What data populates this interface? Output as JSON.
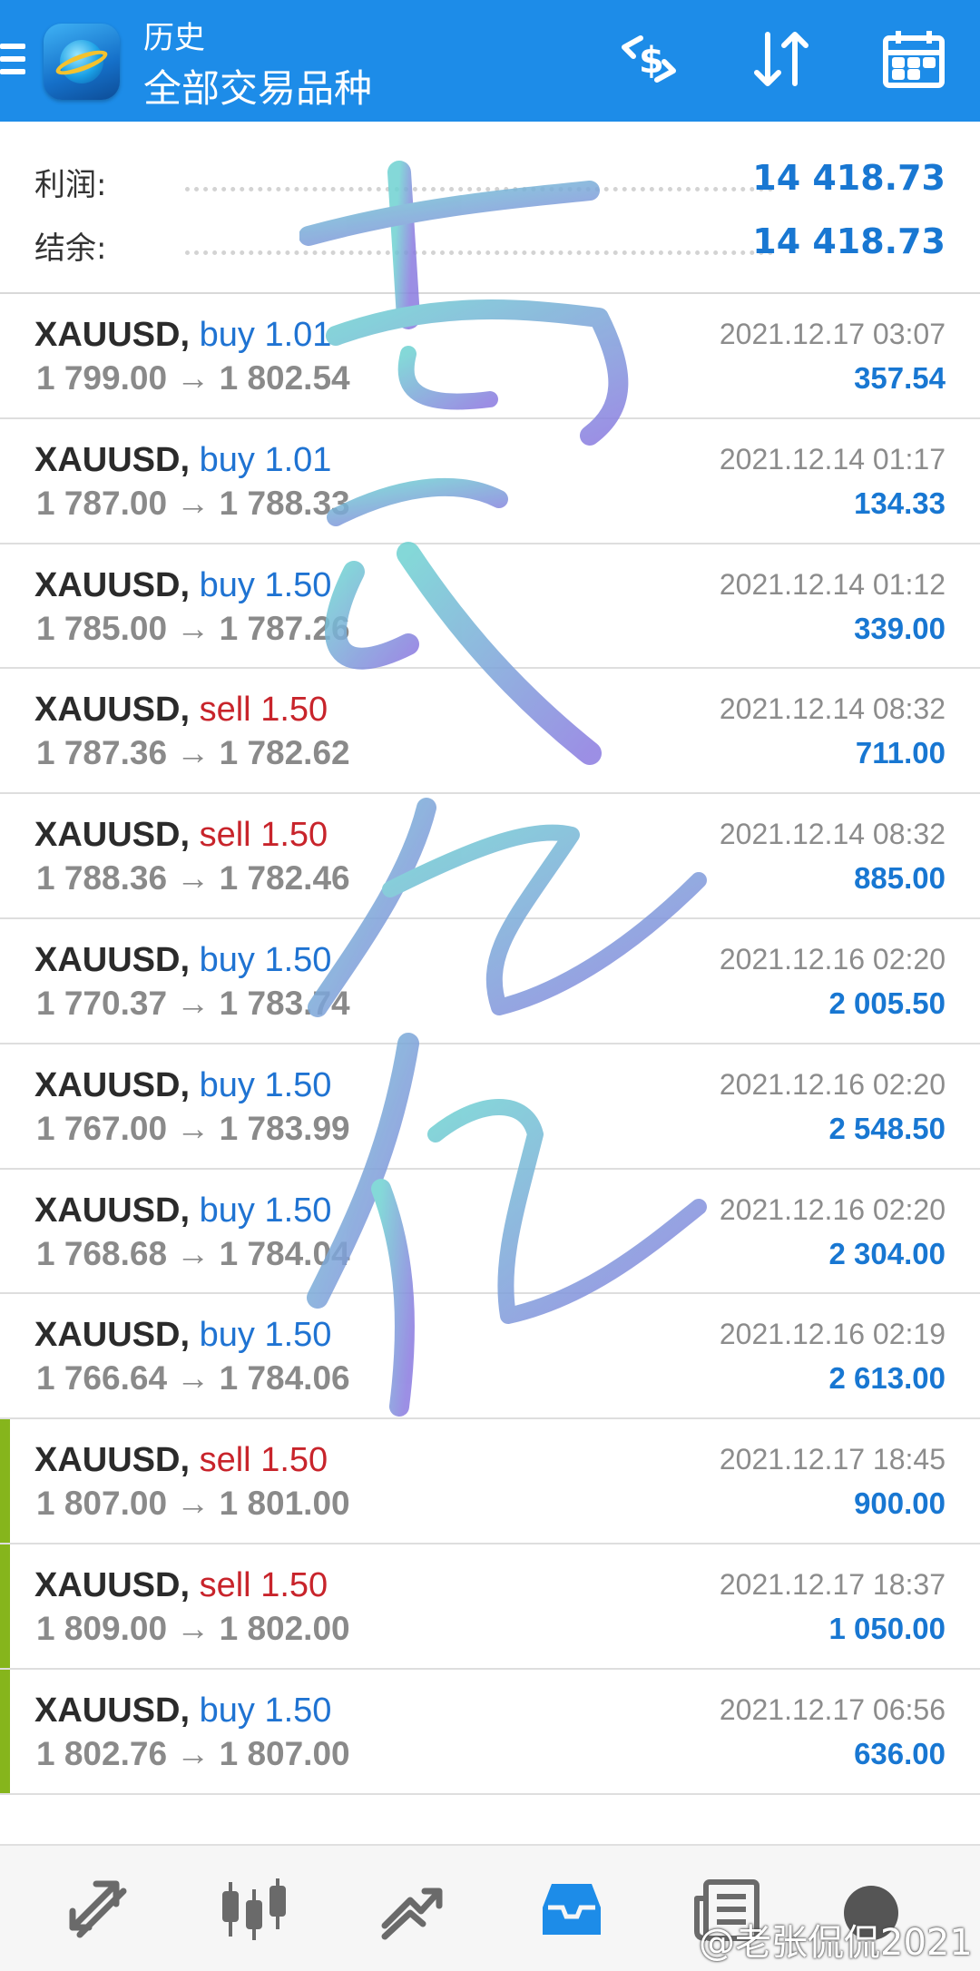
{
  "header": {
    "title": "历史",
    "subtitle": "全部交易品种",
    "icons": [
      "menu-icon",
      "deposit-withdraw-icon",
      "sort-icon",
      "calendar-icon"
    ]
  },
  "summary": {
    "profit_label": "利润:",
    "profit_value": "14 418.73",
    "balance_label": "结余:",
    "balance_value": "14 418.73"
  },
  "trades": [
    {
      "symbol": "XAUUSD,",
      "side": "buy",
      "volume": "1.01",
      "prices": "1 799.00 → 1 802.54",
      "time": "2021.12.17 03:07",
      "profit": "357.54",
      "marked": false
    },
    {
      "symbol": "XAUUSD,",
      "side": "buy",
      "volume": "1.01",
      "prices": "1 787.00 → 1 788.33",
      "time": "2021.12.14 01:17",
      "profit": "134.33",
      "marked": false
    },
    {
      "symbol": "XAUUSD,",
      "side": "buy",
      "volume": "1.50",
      "prices": "1 785.00 → 1 787.26",
      "time": "2021.12.14 01:12",
      "profit": "339.00",
      "marked": false
    },
    {
      "symbol": "XAUUSD,",
      "side": "sell",
      "volume": "1.50",
      "prices": "1 787.36 → 1 782.62",
      "time": "2021.12.14 08:32",
      "profit": "711.00",
      "marked": false
    },
    {
      "symbol": "XAUUSD,",
      "side": "sell",
      "volume": "1.50",
      "prices": "1 788.36 → 1 782.46",
      "time": "2021.12.14 08:32",
      "profit": "885.00",
      "marked": false
    },
    {
      "symbol": "XAUUSD,",
      "side": "buy",
      "volume": "1.50",
      "prices": "1 770.37 → 1 783.74",
      "time": "2021.12.16 02:20",
      "profit": "2 005.50",
      "marked": false
    },
    {
      "symbol": "XAUUSD,",
      "side": "buy",
      "volume": "1.50",
      "prices": "1 767.00 → 1 783.99",
      "time": "2021.12.16 02:20",
      "profit": "2 548.50",
      "marked": false
    },
    {
      "symbol": "XAUUSD,",
      "side": "buy",
      "volume": "1.50",
      "prices": "1 768.68 → 1 784.04",
      "time": "2021.12.16 02:20",
      "profit": "2 304.00",
      "marked": false
    },
    {
      "symbol": "XAUUSD,",
      "side": "buy",
      "volume": "1.50",
      "prices": "1 766.64 → 1 784.06",
      "time": "2021.12.16 02:19",
      "profit": "2 613.00",
      "marked": false
    },
    {
      "symbol": "XAUUSD,",
      "side": "sell",
      "volume": "1.50",
      "prices": "1 807.00 → 1 801.00",
      "time": "2021.12.17 18:45",
      "profit": "900.00",
      "marked": true
    },
    {
      "symbol": "XAUUSD,",
      "side": "sell",
      "volume": "1.50",
      "prices": "1 809.00 → 1 802.00",
      "time": "2021.12.17 18:37",
      "profit": "1 050.00",
      "marked": true
    },
    {
      "symbol": "XAUUSD,",
      "side": "buy",
      "volume": "1.50",
      "prices": "1 802.76 → 1 807.00",
      "time": "2021.12.17 06:56",
      "profit": "636.00",
      "marked": true
    }
  ],
  "watermark_text": "老张侃侃",
  "bottom_nav": {
    "items": [
      "quotes-icon",
      "chart-icon",
      "trade-icon",
      "history-icon",
      "news-icon",
      "chat-icon"
    ],
    "active": "history-icon",
    "weibo_tag": "@老张侃侃2021"
  },
  "colors": {
    "header": "#1d8ce8",
    "value_blue": "#1877d2",
    "buy": "#1f73d2",
    "sell": "#c8242b",
    "marker": "#86b51c"
  }
}
